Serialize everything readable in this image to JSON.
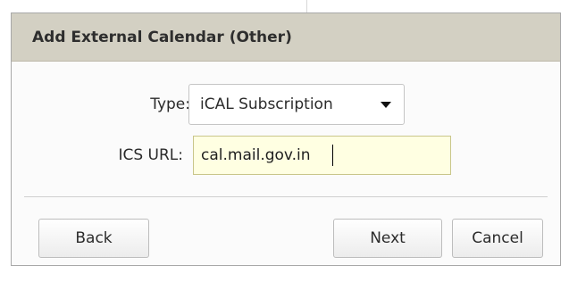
{
  "dialog": {
    "title": "Add External Calendar (Other)"
  },
  "form": {
    "type_label": "Type:",
    "type_value": "iCAL Subscription",
    "url_label": "ICS URL:",
    "url_value": "cal.mail.gov.in"
  },
  "buttons": {
    "back": "Back",
    "next": "Next",
    "cancel": "Cancel"
  },
  "icons": {
    "dropdown": "chevron-down-icon"
  },
  "colors": {
    "header_bg": "#d3d0c3",
    "input_bg": "#ffffe2"
  }
}
